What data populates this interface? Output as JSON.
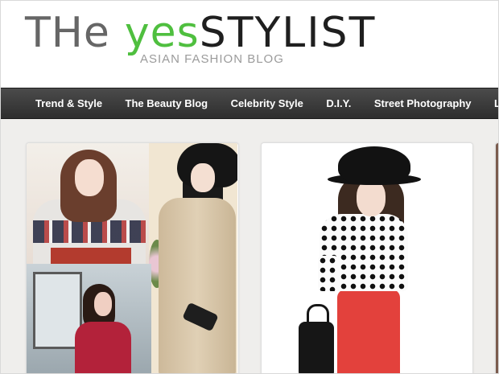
{
  "header": {
    "logo_the": "THe",
    "logo_yes": "yes",
    "logo_stylist": "STYLIST",
    "logo_tagline": "ASIAN FASHION BLOG"
  },
  "nav": {
    "items": [
      {
        "label": "Trend & Style"
      },
      {
        "label": "The Beauty Blog"
      },
      {
        "label": "Celebrity Style"
      },
      {
        "label": "D.I.Y."
      },
      {
        "label": "Street Photography"
      },
      {
        "label": "Lifes"
      }
    ]
  },
  "colors": {
    "accent_green": "#4fbf3f",
    "nav_bg": "#3a3a3a",
    "page_bg": "#efeeec"
  }
}
